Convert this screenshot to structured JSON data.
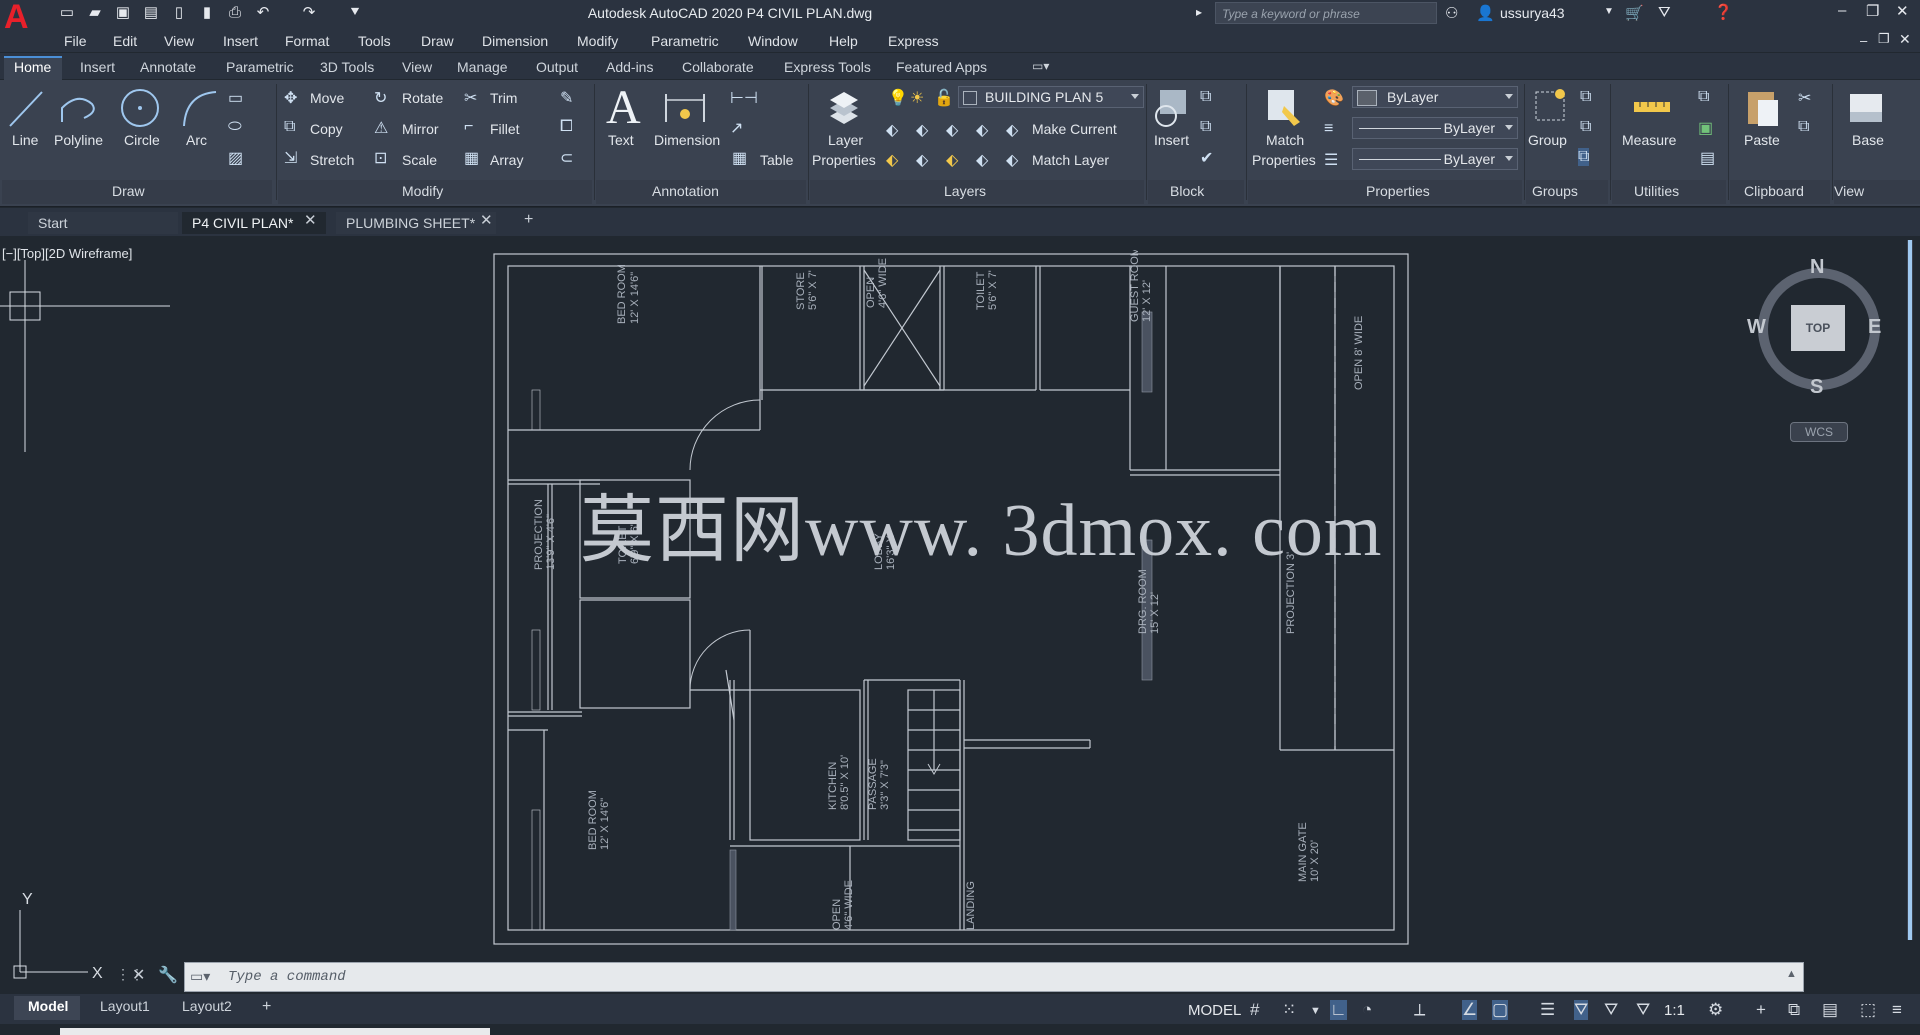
{
  "app": {
    "window_title": "Autodesk AutoCAD 2020   P4 CIVIL PLAN.dwg",
    "search_placeholder": "Type a keyword or phrase",
    "user": "ussurya43"
  },
  "menubar": [
    "File",
    "Edit",
    "View",
    "Insert",
    "Format",
    "Tools",
    "Draw",
    "Dimension",
    "Modify",
    "Parametric",
    "Window",
    "Help",
    "Express"
  ],
  "ribbon_tabs": [
    "Home",
    "Insert",
    "Annotate",
    "Parametric",
    "3D Tools",
    "View",
    "Manage",
    "Output",
    "Add-ins",
    "Collaborate",
    "Express Tools",
    "Featured Apps"
  ],
  "ribbon": {
    "draw": {
      "title": "Draw",
      "line": "Line",
      "polyline": "Polyline",
      "circle": "Circle",
      "arc": "Arc"
    },
    "modify": {
      "title": "Modify",
      "move": "Move",
      "rotate": "Rotate",
      "trim": "Trim",
      "copy": "Copy",
      "mirror": "Mirror",
      "fillet": "Fillet",
      "stretch": "Stretch",
      "scale": "Scale",
      "array": "Array"
    },
    "annotation": {
      "title": "Annotation",
      "text": "Text",
      "dimension": "Dimension",
      "table": "Table"
    },
    "layers": {
      "title": "Layers",
      "layer_properties_1": "Layer",
      "layer_properties_2": "Properties",
      "current_layer": "BUILDING PLAN 5",
      "make_current": "Make Current",
      "match_layer": "Match Layer"
    },
    "block": {
      "title": "Block",
      "insert": "Insert"
    },
    "properties": {
      "title": "Properties",
      "match_1": "Match",
      "match_2": "Properties",
      "color": "ByLayer",
      "linetype": "ByLayer",
      "lineweight": "ByLayer"
    },
    "groups": {
      "title": "Groups",
      "group": "Group"
    },
    "utilities": {
      "title": "Utilities",
      "measure": "Measure"
    },
    "clipboard": {
      "title": "Clipboard",
      "paste": "Paste"
    },
    "view": {
      "title": "View",
      "base": "Base"
    }
  },
  "doc_tabs": {
    "start": "Start",
    "tab1": "P4 CIVIL PLAN*",
    "tab2": "PLUMBING SHEET*"
  },
  "viewport_label": "[−][Top][2D Wireframe]",
  "drawing": {
    "rooms": {
      "bed1": "BED ROOM",
      "bed1_size": "12' X 14'6\"",
      "store": "STORE",
      "store_size": "5'6\" X 7'",
      "open1": "OPEN",
      "open1_size": "4'6\" WIDE",
      "toilet1": "TOILET",
      "toilet1_size": "5'6\" X 7'",
      "guest": "GUEST ROOM",
      "guest_size": "12' X 12'",
      "open8": "OPEN 8' WIDE",
      "projection1": "PROJECTION",
      "projection1_size": "13'9\" X 4'6\"",
      "toilet2": "TOILET",
      "toilet2_size": "6'9\" X 6'",
      "lobby": "LOBBY",
      "lobby_size": "16'3\" X",
      "drg": "DRG. ROOM",
      "drg_size": "15' X 12'",
      "projection2": "PROJECTION 3'",
      "kitchen": "KITCHEN",
      "kitchen_size": "8'0.5\" X 10'",
      "passage": "PASSAGE",
      "passage_size": "3'3\" X 7'3\"",
      "bed2": "BED ROOM",
      "bed2_size": "12' X 14'6\"",
      "main_gate": "MAIN GATE",
      "main_gate_size": "10' X 20'",
      "open2": "OPEN",
      "open2_size": "4'6\" WIDE",
      "landing": "LANDING"
    }
  },
  "watermark": "莫西网www. 3dmox. com",
  "viewcube": {
    "top": "TOP",
    "n": "N",
    "s": "S",
    "e": "E",
    "w": "W",
    "wcs": "WCS"
  },
  "command_placeholder": "Type a command",
  "layout_tabs": [
    "Model",
    "Layout1",
    "Layout2"
  ],
  "status": {
    "model": "MODEL",
    "scale": "1:1"
  },
  "colors": {
    "accent": "#4b8fd6",
    "autocad_red": "#e8202a",
    "canvas": "#212830"
  }
}
